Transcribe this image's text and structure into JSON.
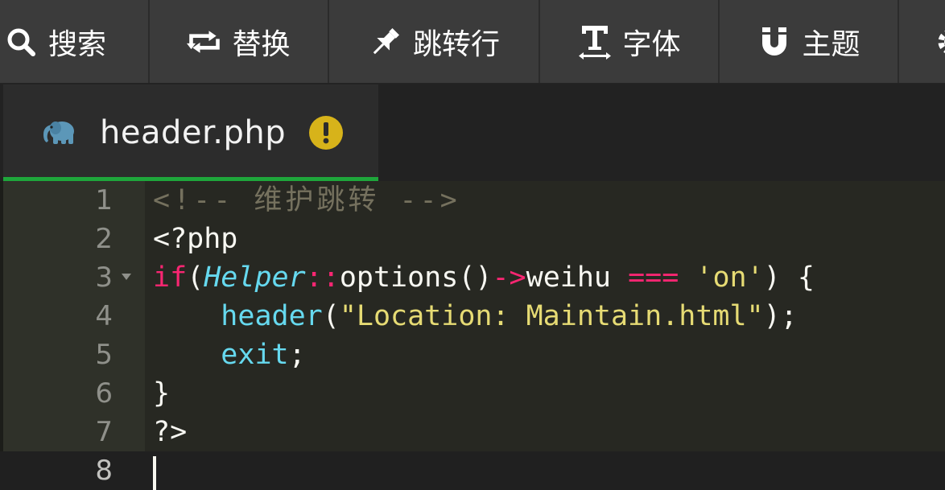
{
  "toolbar": {
    "buttons": [
      {
        "label": "搜索",
        "icon": "search-icon"
      },
      {
        "label": "替换",
        "icon": "replace-icon"
      },
      {
        "label": "跳转行",
        "icon": "pin-icon"
      },
      {
        "label": "字体",
        "icon": "text-icon"
      },
      {
        "label": "主题",
        "icon": "magnet-icon"
      }
    ]
  },
  "tab": {
    "title": "header.php",
    "icon": "php-elephant-icon",
    "status_icon": "warning-icon",
    "underline_color": "#1ea63b"
  },
  "editor": {
    "lines": [
      {
        "num": "1",
        "t": [
          {
            "c": "t-comment",
            "v": "<!-- 维护跳转 -->"
          }
        ]
      },
      {
        "num": "2",
        "t": [
          {
            "c": "t-plain",
            "v": "<?php"
          }
        ]
      },
      {
        "num": "3",
        "t": [
          {
            "c": "t-kw",
            "v": "if"
          },
          {
            "c": "t-plain",
            "v": "("
          },
          {
            "c": "t-class",
            "v": "Helper"
          },
          {
            "c": "t-op",
            "v": "::"
          },
          {
            "c": "t-plain",
            "v": "options()"
          },
          {
            "c": "t-op",
            "v": "->"
          },
          {
            "c": "t-plain",
            "v": "weihu "
          },
          {
            "c": "t-op",
            "v": "==="
          },
          {
            "c": "t-plain",
            "v": " "
          },
          {
            "c": "t-str",
            "v": "'on'"
          },
          {
            "c": "t-plain",
            "v": ") {"
          }
        ]
      },
      {
        "num": "4",
        "t": [
          {
            "c": "t-plain",
            "v": "    "
          },
          {
            "c": "t-fn",
            "v": "header"
          },
          {
            "c": "t-plain",
            "v": "("
          },
          {
            "c": "t-str",
            "v": "\"Location: Maintain.html\""
          },
          {
            "c": "t-plain",
            "v": ");"
          }
        ]
      },
      {
        "num": "5",
        "t": [
          {
            "c": "t-plain",
            "v": "    "
          },
          {
            "c": "t-fn",
            "v": "exit"
          },
          {
            "c": "t-plain",
            "v": ";"
          }
        ]
      },
      {
        "num": "6",
        "t": [
          {
            "c": "t-plain",
            "v": "}"
          }
        ]
      },
      {
        "num": "7",
        "t": [
          {
            "c": "t-plain",
            "v": "?>"
          }
        ]
      },
      {
        "num": "8",
        "t": []
      }
    ],
    "fold_line": "3",
    "cursor_line": "8"
  }
}
